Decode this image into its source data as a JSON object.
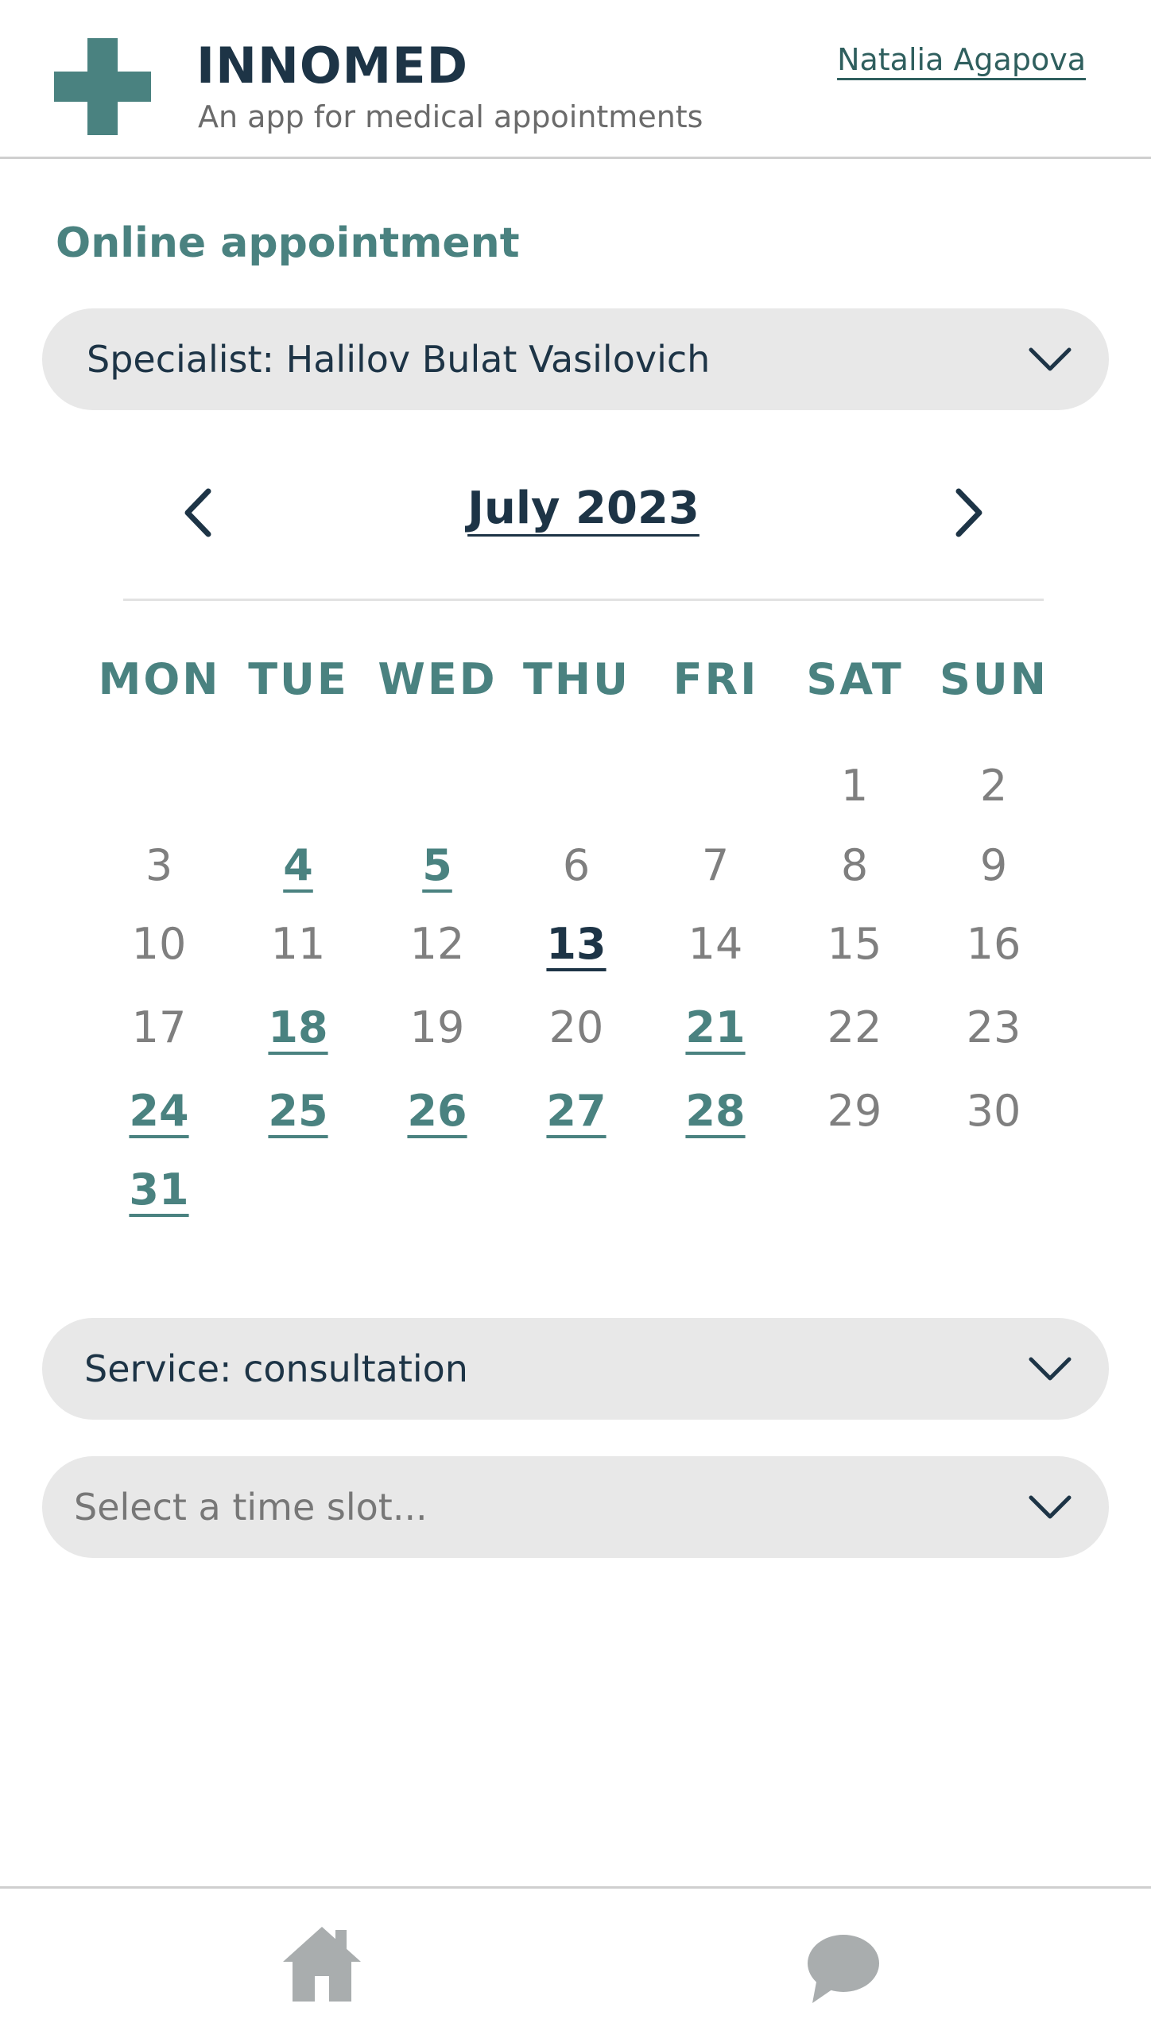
{
  "header": {
    "app_name": "INNOMED",
    "tagline": "An app for medical appointments",
    "user_name": "Natalia Agapova"
  },
  "page": {
    "title": "Online appointment"
  },
  "specialist_select": {
    "label": "Specialist: Halilov Bulat Vasilovich"
  },
  "calendar": {
    "month_label": "July 2023",
    "weekdays": [
      "MON",
      "TUE",
      "WED",
      "THU",
      "FRI",
      "SAT",
      "SUN"
    ],
    "first_weekday_index": 5,
    "days_in_month": 31,
    "available_days": [
      4,
      5,
      18,
      21,
      24,
      25,
      26,
      27,
      28,
      31
    ],
    "selected_day": 13
  },
  "service_select": {
    "label": "Service: consultation"
  },
  "time_select": {
    "placeholder": "Select a time slot..."
  },
  "bottom_nav": {
    "items": [
      {
        "icon": "home-icon"
      },
      {
        "icon": "chat-icon"
      }
    ]
  },
  "colors": {
    "accent": "#4a8280",
    "text_dark": "#1d3446",
    "text_muted": "#7f7f7f",
    "pill_bg": "#e8e8e8",
    "icon_gray": "#a9adae"
  }
}
